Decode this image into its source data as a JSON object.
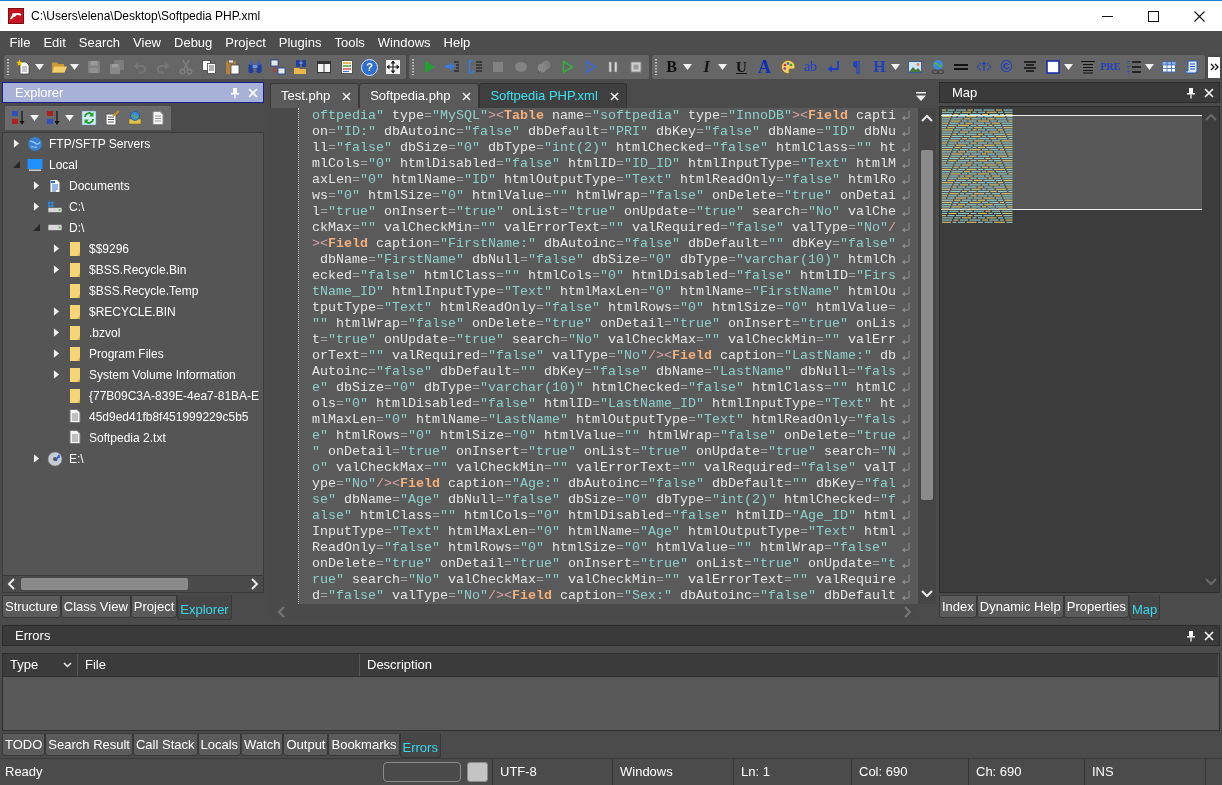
{
  "window": {
    "title": "C:\\Users\\elena\\Desktop\\Softpedia PHP.xml"
  },
  "menu": [
    "File",
    "Edit",
    "Search",
    "View",
    "Debug",
    "Project",
    "Plugins",
    "Tools",
    "Windows",
    "Help"
  ],
  "toolbars": [
    {
      "items": [
        {
          "kind": "new",
          "dropdown": true,
          "disabled": false
        },
        {
          "kind": "open",
          "dropdown": true,
          "disabled": false
        },
        {
          "kind": "save",
          "disabled": true
        },
        {
          "kind": "save-all",
          "disabled": true
        },
        {
          "kind": "undo",
          "disabled": true
        },
        {
          "kind": "redo",
          "disabled": true
        },
        {
          "kind": "cut",
          "disabled": true
        },
        {
          "kind": "copy",
          "disabled": false
        },
        {
          "kind": "paste",
          "disabled": false
        },
        {
          "kind": "find",
          "disabled": false
        },
        {
          "kind": "replace",
          "disabled": false
        },
        {
          "kind": "find-files",
          "disabled": false
        },
        {
          "kind": "panes",
          "disabled": false
        },
        {
          "kind": "outline",
          "disabled": false
        },
        {
          "kind": "help",
          "label": "?",
          "disabled": false
        },
        {
          "kind": "move",
          "disabled": false
        }
      ]
    },
    {
      "items": [
        {
          "kind": "run",
          "disabled": false
        },
        {
          "kind": "step-into",
          "disabled": false
        },
        {
          "kind": "step-out",
          "disabled": false
        },
        {
          "kind": "stop",
          "disabled": true
        },
        {
          "kind": "breakpoint",
          "disabled": true
        },
        {
          "kind": "clear-breakpoints",
          "disabled": true
        },
        {
          "kind": "run-to",
          "disabled": false
        },
        {
          "kind": "step-over",
          "disabled": false
        },
        {
          "kind": "pause",
          "disabled": false
        },
        {
          "kind": "stop-outline",
          "disabled": false
        }
      ]
    },
    {
      "items": [
        {
          "kind": "bold",
          "label": "B",
          "dropdown": true
        },
        {
          "kind": "italic",
          "label": "I",
          "dropdown": true
        },
        {
          "kind": "underline",
          "label": "U"
        },
        {
          "kind": "font-color",
          "label": "A"
        },
        {
          "kind": "palette"
        },
        {
          "kind": "span",
          "label": "ab"
        },
        {
          "kind": "line-break"
        },
        {
          "kind": "paragraph",
          "label": "¶"
        },
        {
          "kind": "heading",
          "label": "H",
          "dropdown": true
        },
        {
          "kind": "image"
        },
        {
          "kind": "link"
        },
        {
          "kind": "rule"
        },
        {
          "kind": "anchor"
        },
        {
          "kind": "copyright",
          "label": "©"
        },
        {
          "kind": "center"
        },
        {
          "kind": "border",
          "dropdown": true
        },
        {
          "kind": "justify"
        },
        {
          "kind": "pre",
          "label": "PRE"
        },
        {
          "kind": "list",
          "dropdown": true
        },
        {
          "kind": "table"
        },
        {
          "kind": "script"
        }
      ]
    }
  ],
  "explorer": {
    "title": "Explorer",
    "active": true,
    "toolbar": [
      {
        "kind": "sort-asc",
        "dropdown": true
      },
      {
        "kind": "sort-desc",
        "dropdown": true
      },
      {
        "kind": "refresh"
      },
      {
        "kind": "properties"
      },
      {
        "kind": "network-settings"
      },
      {
        "kind": "page"
      }
    ],
    "tree": [
      {
        "label": "FTP/SFTP Servers",
        "kind": "network",
        "expandable": true,
        "expanded": false
      },
      {
        "label": "Local",
        "kind": "computer",
        "expandable": true,
        "expanded": true,
        "children": [
          {
            "label": "Documents",
            "kind": "documents",
            "expandable": true,
            "expanded": false
          },
          {
            "label": "C:\\",
            "kind": "system-drive",
            "expandable": true,
            "expanded": false
          },
          {
            "label": "D:\\",
            "kind": "drive",
            "expandable": true,
            "expanded": true,
            "children": [
              {
                "label": "$$9296",
                "kind": "folder",
                "expandable": true,
                "expanded": false
              },
              {
                "label": "$BSS.Recycle.Bin",
                "kind": "folder",
                "expandable": true,
                "expanded": false
              },
              {
                "label": "$BSS.Recycle.Temp",
                "kind": "folder",
                "expandable": false
              },
              {
                "label": "$RECYCLE.BIN",
                "kind": "folder",
                "expandable": true,
                "expanded": false
              },
              {
                "label": ".bzvol",
                "kind": "folder",
                "expandable": true,
                "expanded": false
              },
              {
                "label": "Program Files",
                "kind": "folder",
                "expandable": true,
                "expanded": false
              },
              {
                "label": "System Volume Information",
                "kind": "folder",
                "expandable": true,
                "expanded": false
              },
              {
                "label": "{77B09C3A-839E-4ea7-81BA-E",
                "kind": "folder",
                "expandable": false
              },
              {
                "label": "45d9ed41fb8f451999229c5b5",
                "kind": "file",
                "expandable": false
              },
              {
                "label": "Softpedia 2.txt",
                "kind": "file",
                "expandable": false
              }
            ]
          },
          {
            "label": "E:\\",
            "kind": "disc",
            "expandable": true,
            "expanded": false
          }
        ]
      }
    ],
    "tabs": [
      {
        "label": "Structure",
        "selected": false
      },
      {
        "label": "Class View",
        "selected": false
      },
      {
        "label": "Project",
        "selected": false
      },
      {
        "label": "Explorer",
        "selected": true
      }
    ]
  },
  "editor": {
    "tabs": [
      {
        "label": "Test.php",
        "selected": false
      },
      {
        "label": "Softpedia.php",
        "selected": false
      },
      {
        "label": "Softpedia PHP.xml",
        "selected": true
      }
    ],
    "lines": [
      "oftpedia\" type=\"MySQL\"><Table name=\"softpedia\" type=\"InnoDB\"><Field capti",
      "on=\"ID:\" dbAutoinc=\"false\" dbDefault=\"PRI\" dbKey=\"false\" dbName=\"ID\" dbNu",
      "ll=\"false\" dbSize=\"0\" dbType=\"int(2)\" htmlChecked=\"false\" htmlClass=\"\" ht",
      "mlCols=\"0\" htmlDisabled=\"false\" htmlID=\"ID_ID\" htmlInputType=\"Text\" htmlM",
      "axLen=\"0\" htmlName=\"ID\" htmlOutputType=\"Text\" htmlReadOnly=\"false\" htmlRo",
      "ws=\"0\" htmlSize=\"0\" htmlValue=\"\" htmlWrap=\"false\" onDelete=\"true\" onDetai",
      "l=\"true\" onInsert=\"true\" onList=\"true\" onUpdate=\"true\" search=\"No\" valChe",
      "ckMax=\"\" valCheckMin=\"\" valErrorText=\"\" valRequired=\"false\" valType=\"No\"/",
      "><Field caption=\"FirstName:\" dbAutoinc=\"false\" dbDefault=\"\" dbKey=\"false\"",
      " dbName=\"FirstName\" dbNull=\"false\" dbSize=\"0\" dbType=\"varchar(10)\" htmlCh",
      "ecked=\"false\" htmlClass=\"\" htmlCols=\"0\" htmlDisabled=\"false\" htmlID=\"Firs",
      "tName_ID\" htmlInputType=\"Text\" htmlMaxLen=\"0\" htmlName=\"FirstName\" htmlOu",
      "tputType=\"Text\" htmlReadOnly=\"false\" htmlRows=\"0\" htmlSize=\"0\" htmlValue=",
      "\"\" htmlWrap=\"false\" onDelete=\"true\" onDetail=\"true\" onInsert=\"true\" onLis",
      "t=\"true\" onUpdate=\"true\" search=\"No\" valCheckMax=\"\" valCheckMin=\"\" valErr",
      "orText=\"\" valRequired=\"false\" valType=\"No\"/><Field caption=\"LastName:\" db",
      "Autoinc=\"false\" dbDefault=\"\" dbKey=\"false\" dbName=\"LastName\" dbNull=\"fals",
      "e\" dbSize=\"0\" dbType=\"varchar(10)\" htmlChecked=\"false\" htmlClass=\"\" htmlC",
      "ols=\"0\" htmlDisabled=\"false\" htmlID=\"LastName_ID\" htmlInputType=\"Text\" ht",
      "mlMaxLen=\"0\" htmlName=\"LastName\" htmlOutputType=\"Text\" htmlReadOnly=\"fals",
      "e\" htmlRows=\"0\" htmlSize=\"0\" htmlValue=\"\" htmlWrap=\"false\" onDelete=\"true",
      "\" onDetail=\"true\" onInsert=\"true\" onList=\"true\" onUpdate=\"true\" search=\"N",
      "o\" valCheckMax=\"\" valCheckMin=\"\" valErrorText=\"\" valRequired=\"false\" valT",
      "ype=\"No\"/><Field caption=\"Age:\" dbAutoinc=\"false\" dbDefault=\"\" dbKey=\"fal",
      "se\" dbName=\"Age\" dbNull=\"false\" dbSize=\"0\" dbType=\"int(2)\" htmlChecked=\"f",
      "alse\" htmlClass=\"\" htmlCols=\"0\" htmlDisabled=\"false\" htmlID=\"Age_ID\" html",
      "InputType=\"Text\" htmlMaxLen=\"0\" htmlName=\"Age\" htmlOutputType=\"Text\" html",
      "ReadOnly=\"false\" htmlRows=\"0\" htmlSize=\"0\" htmlValue=\"\" htmlWrap=\"false\"",
      "onDelete=\"true\" onDetail=\"true\" onInsert=\"true\" onList=\"true\" onUpdate=\"t",
      "rue\" search=\"No\" valCheckMax=\"\" valCheckMin=\"\" valErrorText=\"\" valRequire",
      "d=\"false\" valType=\"No\"/><Field caption=\"Sex:\" dbAutoinc=\"false\" dbDefault"
    ]
  },
  "map": {
    "title": "Map",
    "active": false,
    "tabs": [
      {
        "label": "Index",
        "selected": false
      },
      {
        "label": "Dynamic Help",
        "selected": false
      },
      {
        "label": "Properties",
        "selected": false
      },
      {
        "label": "Map",
        "selected": true
      }
    ]
  },
  "errors": {
    "title": "Errors",
    "active": false,
    "columns": [
      {
        "label": "Type",
        "dropdown": true
      },
      {
        "label": "File"
      },
      {
        "label": "Description"
      }
    ],
    "tabs": [
      {
        "label": "TODO",
        "selected": false
      },
      {
        "label": "Search Result",
        "selected": false
      },
      {
        "label": "Call Stack",
        "selected": false
      },
      {
        "label": "Locals",
        "selected": false
      },
      {
        "label": "Watch",
        "selected": false
      },
      {
        "label": "Output",
        "selected": false
      },
      {
        "label": "Bookmarks",
        "selected": false
      },
      {
        "label": "Errors",
        "selected": true
      }
    ]
  },
  "status_bar": {
    "message": "Ready",
    "encoding": "UTF-8",
    "line_endings": "Windows",
    "line": "Ln: 1",
    "column": "Col: 690",
    "character": "Ch: 690",
    "mode": "INS"
  }
}
